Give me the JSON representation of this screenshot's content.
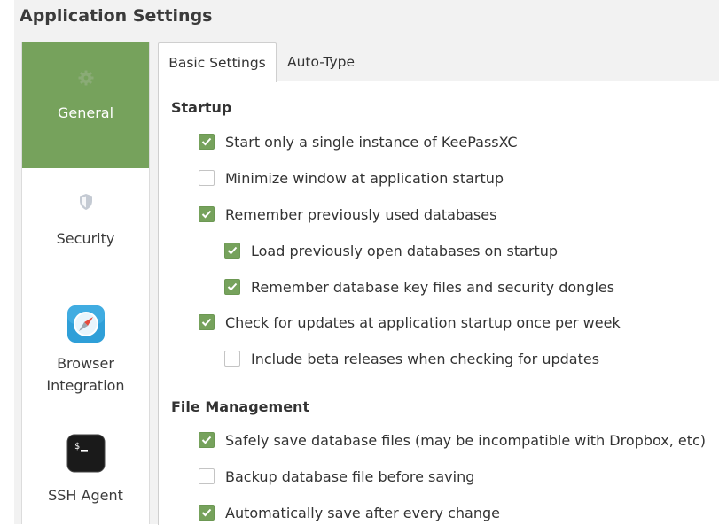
{
  "window": {
    "title": "Application Settings"
  },
  "sidebar": {
    "items": [
      {
        "label": "General",
        "icon": "gear-icon",
        "active": true
      },
      {
        "label": "Security",
        "icon": "shield-icon",
        "active": false
      },
      {
        "label": "Browser\nIntegration",
        "label_line1": "Browser",
        "label_line2": "Integration",
        "icon": "compass-icon",
        "active": false
      },
      {
        "label": "SSH Agent",
        "icon": "terminal-icon",
        "active": false
      }
    ]
  },
  "tabs": [
    {
      "label": "Basic Settings",
      "active": true
    },
    {
      "label": "Auto-Type",
      "active": false
    }
  ],
  "startup": {
    "title": "Startup",
    "options": [
      {
        "label": "Start only a single instance of KeePassXC",
        "checked": true
      },
      {
        "label": "Minimize window at application startup",
        "checked": false
      },
      {
        "label": "Remember previously used databases",
        "checked": true
      },
      {
        "label": "Load previously open databases on startup",
        "checked": true
      },
      {
        "label": "Remember database key files and security dongles",
        "checked": true
      },
      {
        "label": "Check for updates at application startup once per week",
        "checked": true
      },
      {
        "label": "Include beta releases when checking for updates",
        "checked": false
      }
    ]
  },
  "file_management": {
    "title": "File Management",
    "options": [
      {
        "label": "Safely save database files (may be incompatible with Dropbox, etc)",
        "checked": true
      },
      {
        "label": "Backup database file before saving",
        "checked": false
      },
      {
        "label": "Automatically save after every change",
        "checked": true
      }
    ]
  },
  "colors": {
    "accent": "#76a25c",
    "window_bg": "#f2f2f2",
    "panel_bg": "#ffffff",
    "text": "#333333"
  }
}
